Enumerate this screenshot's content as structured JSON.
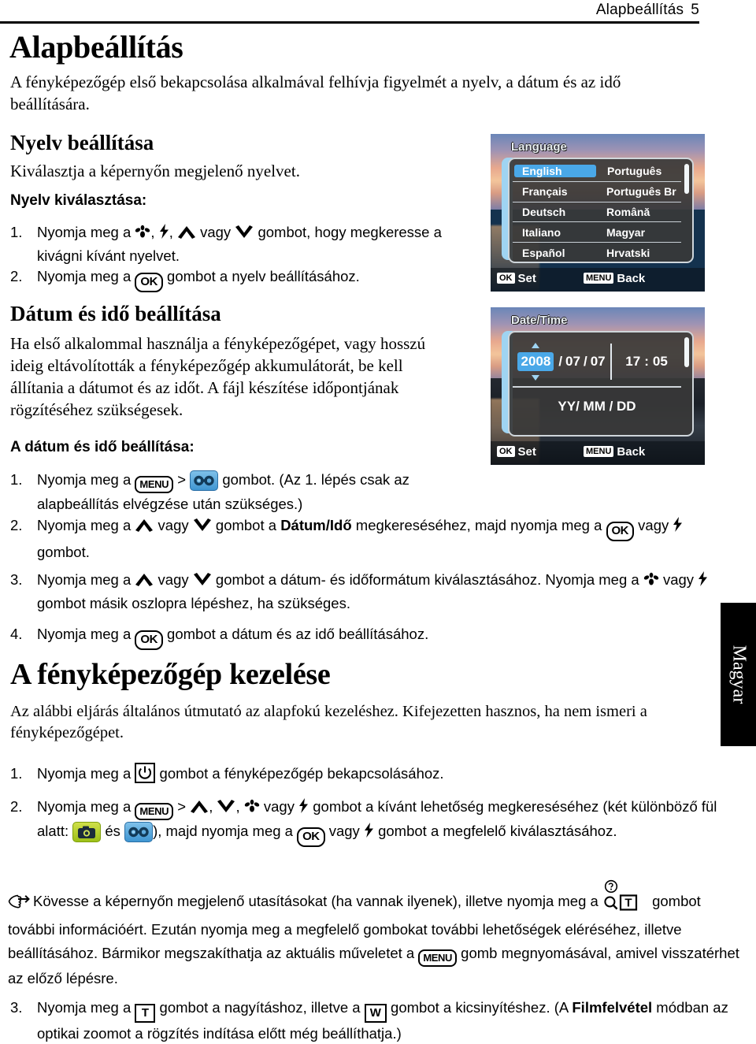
{
  "header": {
    "title": "Alapbeállítás",
    "page": "5"
  },
  "main": {
    "h1": "Alapbeállítás",
    "intro": "A fényképezőgép első bekapcsolása alkalmával felhívja figyelmét a nyelv, a dátum és az idő beállítására.",
    "section_language": {
      "heading": "Nyelv beállítása",
      "body": "Kiválasztja a képernyőn megjelenő nyelvet.",
      "subheading": "Nyelv kiválasztása:",
      "steps": [
        {
          "n": "1.",
          "pre": "Nyomja meg a ",
          "mid": ", ",
          "mid2": ", ",
          "vagy": " vagy ",
          "post": " gombot, hogy megkeresse a kivágni kívánt nyelvet."
        },
        {
          "n": "2.",
          "pre": "Nyomja meg a ",
          "post": " gombot a nyelv beállításához."
        }
      ]
    },
    "section_datetime": {
      "heading": "Dátum és idő beállítása",
      "body": "Ha első alkalommal használja a fényképezőgépet, vagy hosszú ideig eltávolították a fényképezőgép akkumulátorát, be kell állítania a dátumot és az időt. A fájl készítése időpontjának rögzítéséhez szükségesek.",
      "subheading": "A dátum és idő beállítása:",
      "steps": [
        {
          "n": "1.",
          "a": "Nyomja meg a ",
          "b": " > ",
          "c": " gombot. (Az 1. lépés csak az alapbeállítás elvégzése után szükséges.)"
        },
        {
          "n": "2.",
          "a": "Nyomja meg a ",
          "b": " vagy ",
          "c": " gombot a ",
          "bold": "Dátum/Idő",
          "d": " megkereséséhez, majd nyomja meg a ",
          "e": " vagy ",
          "f": " gombot."
        },
        {
          "n": "3.",
          "a": "Nyomja meg a ",
          "b": " vagy ",
          "c": " gombot a dátum- és időformátum kiválasztásához. Nyomja meg a ",
          "d": " vagy ",
          "e": " gombot másik oszlopra lépéshez, ha szükséges."
        },
        {
          "n": "4.",
          "a": "Nyomja meg a ",
          "b": " gombot a dátum és az idő beállításához."
        }
      ]
    },
    "section_camera": {
      "heading": "A fényképezőgép kezelése",
      "body": "Az alábbi eljárás általános útmutató az alapfokú kezeléshez. Kifejezetten hasznos, ha nem ismeri a fényképezőgépet.",
      "steps": [
        {
          "n": "1.",
          "a": "Nyomja meg a ",
          "b": " gombot a fényképezőgép bekapcsolásához."
        },
        {
          "n": "2.",
          "a": "Nyomja meg a ",
          "b": " > ",
          "c": ", ",
          "d": ", ",
          "e": " vagy ",
          "f": " gombot a kívánt lehetőség megkereséséhez (két különböző fül alatt: ",
          "g": " és ",
          "h": "), majd nyomja meg a ",
          "i": " vagy ",
          "j": " gombot a megfelelő kiválasztásához."
        },
        {
          "n": "3.",
          "a": "Nyomja meg a ",
          "b": " gombot a nagyításhoz, illetve a ",
          "c": " gombot a kicsinyítéshez. (A ",
          "bold": "Filmfelvétel",
          "d": " módban az optikai zoomot a rögzítés indítása előtt még beállíthatja.)"
        }
      ],
      "note": {
        "a": "Kövesse a képernyőn megjelenő utasításokat (ha vannak ilyenek), illetve nyomja meg a ",
        "b": " gombot további információért. Ezután nyomja meg a megfelelő gombokat további lehetőségek eléréséhez, illetve beállításához. Bármikor megszakíthatja az aktuális műveletet a ",
        "c": " gomb megnyomásával, amivel visszatérhet az előző lépésre."
      }
    }
  },
  "side_tab": {
    "label": "Magyar"
  },
  "buttons": {
    "ok": "OK",
    "menu": "MENU",
    "tele": "T",
    "wide": "W"
  },
  "screenshot_language": {
    "title": "Language",
    "rows": [
      {
        "left": "English",
        "right": "Português",
        "selected": "left"
      },
      {
        "left": "Français",
        "right": "Português Br",
        "selected": ""
      },
      {
        "left": "Deutsch",
        "right": "Română",
        "selected": ""
      },
      {
        "left": "Italiano",
        "right": "Magyar",
        "selected": ""
      },
      {
        "left": "Español",
        "right": "Hrvatski",
        "selected": ""
      }
    ],
    "foot": {
      "ok_key": "OK",
      "ok_label": "Set",
      "menu_key": "MENU",
      "menu_label": "Back"
    }
  },
  "screenshot_datetime": {
    "title": "Date/Time",
    "year": "2008",
    "sep1": "/",
    "month": "07",
    "sep2": "/",
    "day": "07",
    "hour": "17",
    "colon": ":",
    "minute": "05",
    "format": "YY/ MM / DD",
    "foot": {
      "ok_key": "OK",
      "ok_label": "Set",
      "menu_key": "MENU",
      "menu_label": "Back"
    }
  },
  "colors": {
    "accent_blue": "#4aa8e8",
    "tile_green": "#a9c919",
    "tile_blue": "#5aadde"
  }
}
